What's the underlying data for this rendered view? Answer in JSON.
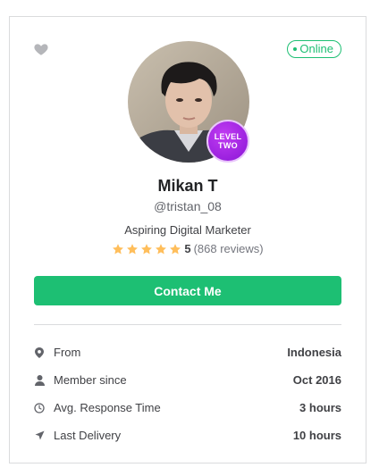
{
  "profile": {
    "status": "Online",
    "name": "Mikan T",
    "username": "@tristan_08",
    "level_line1": "LEVEL",
    "level_line2": "TWO",
    "tagline": "Aspiring Digital Marketer",
    "rating": "5",
    "reviews": "(868 reviews)",
    "stars": 5
  },
  "actions": {
    "contact_label": "Contact Me"
  },
  "info": [
    {
      "icon": "location-pin-icon",
      "label": "From",
      "value": "Indonesia"
    },
    {
      "icon": "user-icon",
      "label": "Member since",
      "value": "Oct 2016"
    },
    {
      "icon": "clock-icon",
      "label": "Avg. Response Time",
      "value": "3 hours"
    },
    {
      "icon": "send-icon",
      "label": "Last Delivery",
      "value": "10 hours"
    }
  ],
  "colors": {
    "accent": "#1dbf73",
    "star": "#ffbe5b",
    "level_badge": "#a020e0"
  }
}
